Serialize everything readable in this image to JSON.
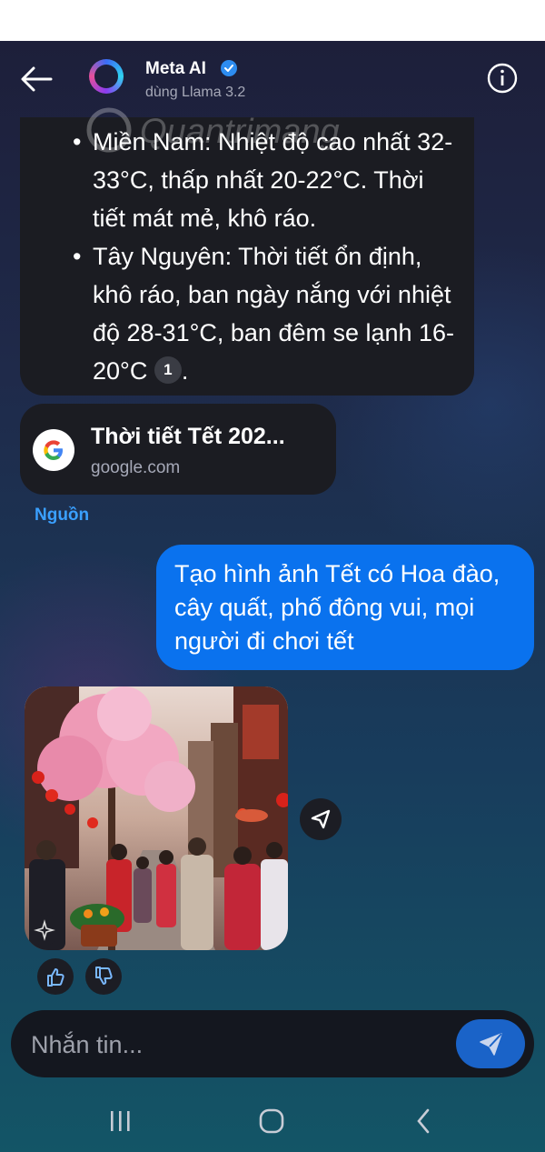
{
  "header": {
    "title": "Meta AI",
    "subtitle": "dùng Llama 3.2",
    "back_icon": "arrow-left-icon",
    "info_icon": "info-icon",
    "verified_icon": "verified-badge-icon"
  },
  "bot_message": {
    "items": [
      {
        "text": "Miền Nam: Nhiệt độ cao nhất 32-33°C, thấp nhất 20-22°C. Thời tiết mát mẻ, khô ráo."
      },
      {
        "text": "Tây Nguyên: Thời tiết ổn định, khô ráo, ban ngày nắng với nhiệt độ 28-31°C, ban đêm se lạnh 16-20°C",
        "citation": "1",
        "suffix": "."
      }
    ]
  },
  "watermark": "Quantrimang",
  "source_card": {
    "title": "Thời tiết Tết 202...",
    "domain": "google.com",
    "icon": "google-g-icon"
  },
  "sources_label": "Nguồn",
  "user_message": "Tạo hình ảnh Tết có Hoa đào, cây quất, phố đông vui, mọi người đi chơi tết",
  "generated_image": {
    "alt": "Tết street scene with peach blossom tree, lanterns and crowd"
  },
  "reactions": {
    "like_icon": "thumbs-up-icon",
    "dislike_icon": "thumbs-down-icon"
  },
  "composer": {
    "placeholder": "Nhắn tin...",
    "send_icon": "send-icon"
  },
  "navbar": {
    "recent_icon": "recent-apps-icon",
    "home_icon": "home-icon",
    "back_icon": "back-chevron-icon"
  },
  "colors": {
    "accent": "#0a72ee",
    "link": "#3aa0ff",
    "bubble_dark": "#1b1c22"
  }
}
